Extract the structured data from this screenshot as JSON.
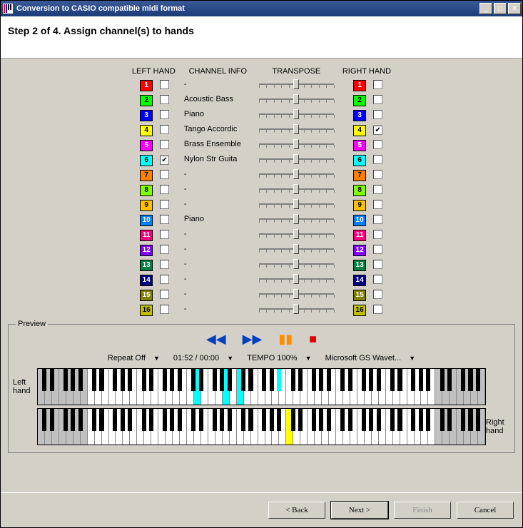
{
  "window": {
    "title": "Conversion to CASIO compatible midi format"
  },
  "step": {
    "text": "Step 2 of 4. Assign channel(s) to hands"
  },
  "headers": {
    "left": "LEFT HAND",
    "info": "CHANNEL INFO",
    "transpose": "TRANSPOSE",
    "right": "RIGHT HAND"
  },
  "channels": [
    {
      "n": "1",
      "color": "#ff0000",
      "fg": "#fff",
      "lchk": false,
      "rchk": false,
      "info": "-"
    },
    {
      "n": "2",
      "color": "#00ff00",
      "fg": "#000",
      "lchk": false,
      "rchk": false,
      "info": "Acoustic Bass"
    },
    {
      "n": "3",
      "color": "#0000ff",
      "fg": "#fff",
      "lchk": false,
      "rchk": false,
      "info": "Piano"
    },
    {
      "n": "4",
      "color": "#ffff00",
      "fg": "#000",
      "lchk": false,
      "rchk": true,
      "info": "Tango Accordic"
    },
    {
      "n": "5",
      "color": "#ff00ff",
      "fg": "#fff",
      "lchk": false,
      "rchk": false,
      "info": "Brass Ensemble"
    },
    {
      "n": "6",
      "color": "#00ffff",
      "fg": "#000",
      "lchk": true,
      "rchk": false,
      "info": "Nylon Str Guita"
    },
    {
      "n": "7",
      "color": "#ff8000",
      "fg": "#000",
      "lchk": false,
      "rchk": false,
      "info": "-"
    },
    {
      "n": "8",
      "color": "#80ff00",
      "fg": "#000",
      "lchk": false,
      "rchk": false,
      "info": "-"
    },
    {
      "n": "9",
      "color": "#ffc000",
      "fg": "#000",
      "lchk": false,
      "rchk": false,
      "info": "-"
    },
    {
      "n": "10",
      "color": "#0080ff",
      "fg": "#fff",
      "lchk": false,
      "rchk": false,
      "info": "Piano"
    },
    {
      "n": "11",
      "color": "#ff0080",
      "fg": "#fff",
      "lchk": false,
      "rchk": false,
      "info": "-"
    },
    {
      "n": "12",
      "color": "#8000ff",
      "fg": "#fff",
      "lchk": false,
      "rchk": false,
      "info": "-"
    },
    {
      "n": "13",
      "color": "#008040",
      "fg": "#fff",
      "lchk": false,
      "rchk": false,
      "info": "-"
    },
    {
      "n": "14",
      "color": "#000080",
      "fg": "#fff",
      "lchk": false,
      "rchk": false,
      "info": "-"
    },
    {
      "n": "15",
      "color": "#808000",
      "fg": "#fff",
      "lchk": false,
      "rchk": false,
      "info": "-"
    },
    {
      "n": "16",
      "color": "#c0c000",
      "fg": "#000",
      "lchk": false,
      "rchk": false,
      "info": "-"
    }
  ],
  "preview": {
    "label": "Preview",
    "left_label": "Left hand",
    "right_label": "Right hand",
    "repeat": "Repeat Off",
    "time": "01:52 / 00:00",
    "tempo": "TEMPO 100%",
    "device": "Microsoft GS Wavet..."
  },
  "buttons": {
    "back": "< Back",
    "next": "Next >",
    "finish": "Finish",
    "cancel": "Cancel"
  }
}
